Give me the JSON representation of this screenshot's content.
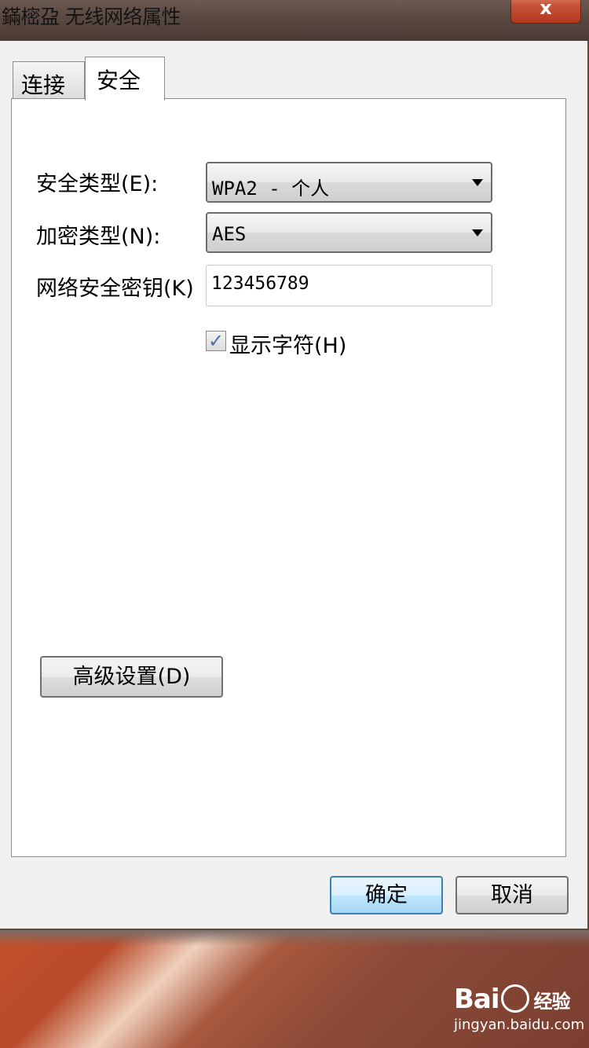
{
  "window": {
    "title": "鏋樒盁 无线网络属性"
  },
  "tabs": [
    {
      "label": "连接"
    },
    {
      "label": "安全"
    }
  ],
  "security": {
    "security_type_label": "安全类型(E):",
    "security_type_value": "WPA2 - 个人",
    "encryption_type_label": "加密类型(N):",
    "encryption_type_value": "AES",
    "network_key_label": "网络安全密钥(K)",
    "network_key_value": "123456789",
    "show_chars_label": "显示字符(H)",
    "show_chars_checked": true,
    "advanced_button": "高级设置(D)"
  },
  "footer": {
    "ok_label": "确定",
    "cancel_label": "取消"
  },
  "watermark": {
    "brand_a": "Bai",
    "brand_b": "经验",
    "url": "jingyan.baidu.com"
  },
  "colors": {
    "close_button": "#c8543a",
    "default_button_border": "#3c7fb1",
    "checkmark": "#4a6fb5"
  }
}
